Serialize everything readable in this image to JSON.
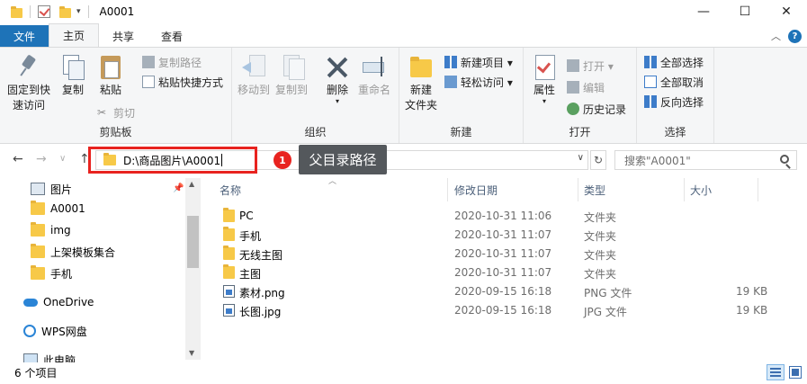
{
  "window": {
    "title": "A0001",
    "minimize": "—",
    "maximize": "☐",
    "close": "✕"
  },
  "quick_access": {
    "dropdown": "▾"
  },
  "ribbon_tabs": {
    "file": "文件",
    "home": "主页",
    "share": "共享",
    "view": "查看",
    "collapse": "︿",
    "help": "?"
  },
  "ribbon": {
    "clipboard": {
      "label": "剪贴板",
      "pin_line1": "固定到快",
      "pin_line2": "速访问",
      "copy": "复制",
      "paste": "粘贴",
      "copy_path": "复制路径",
      "paste_shortcut": "粘贴快捷方式",
      "cut": "剪切"
    },
    "organize": {
      "label": "组织",
      "move_to": "移动到",
      "copy_to": "复制到",
      "delete": "删除",
      "rename": "重命名",
      "dropdown": "▾"
    },
    "new": {
      "label": "新建",
      "new_folder_line1": "新建",
      "new_folder_line2": "文件夹",
      "new_item": "新建项目 ▾",
      "easy_access": "轻松访问 ▾"
    },
    "open": {
      "label": "打开",
      "properties": "属性",
      "open": "打开 ▾",
      "edit": "编辑",
      "history": "历史记录"
    },
    "select": {
      "label": "选择",
      "select_all": "全部选择",
      "select_none": "全部取消",
      "invert": "反向选择"
    }
  },
  "nav": {
    "back": "←",
    "forward": "→",
    "recent": "∨",
    "up": "↑",
    "address": "D:\\商品图片\\A0001",
    "address_dropdown": "∨",
    "refresh": "↻",
    "search_placeholder": "搜索\"A0001\""
  },
  "annotation": {
    "number": "1",
    "text": "父目录路径",
    "color": "#e8231f"
  },
  "sidebar": {
    "items": [
      {
        "label": "图片",
        "icon": "picture-icon"
      },
      {
        "label": "A0001",
        "icon": "folder-icon"
      },
      {
        "label": "img",
        "icon": "folder-icon"
      },
      {
        "label": "上架模板集合",
        "icon": "folder-icon"
      },
      {
        "label": "手机",
        "icon": "folder-icon"
      },
      {
        "label": "OneDrive",
        "icon": "cloud-icon"
      },
      {
        "label": "WPS网盘",
        "icon": "wps-icon"
      },
      {
        "label": "此电脑",
        "icon": "computer-icon"
      }
    ]
  },
  "columns": {
    "name": "名称",
    "modified": "修改日期",
    "type": "类型",
    "size": "大小"
  },
  "files": [
    {
      "name": "PC",
      "modified": "2020-10-31 11:06",
      "type": "文件夹",
      "size": "",
      "icon": "folder-icon"
    },
    {
      "name": "手机",
      "modified": "2020-10-31 11:07",
      "type": "文件夹",
      "size": "",
      "icon": "folder-icon"
    },
    {
      "name": "无线主图",
      "modified": "2020-10-31 11:07",
      "type": "文件夹",
      "size": "",
      "icon": "folder-icon"
    },
    {
      "name": "主图",
      "modified": "2020-10-31 11:07",
      "type": "文件夹",
      "size": "",
      "icon": "folder-icon"
    },
    {
      "name": "素材.png",
      "modified": "2020-09-15 16:18",
      "type": "PNG 文件",
      "size": "19 KB",
      "icon": "image-file-icon"
    },
    {
      "name": "长图.jpg",
      "modified": "2020-09-15 16:18",
      "type": "JPG 文件",
      "size": "19 KB",
      "icon": "image-file-icon"
    }
  ],
  "status": {
    "count": "6 个项目"
  }
}
